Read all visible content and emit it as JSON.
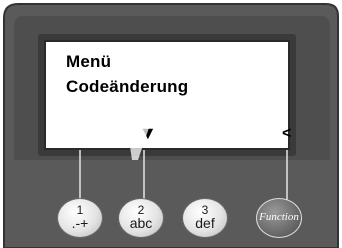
{
  "display": {
    "line1": "Menü",
    "line2": "Codeänderung",
    "selection_indicator": "▼",
    "back_indicator": "<"
  },
  "keys": [
    {
      "number": "1",
      "letters": ".-+"
    },
    {
      "number": "2",
      "letters": "abc"
    },
    {
      "number": "3",
      "letters": "def"
    },
    {
      "label": "Function"
    }
  ],
  "colors": {
    "panel": "#555555",
    "panel_edge": "#3a3a3a",
    "display_bg": "#ffffff",
    "display_text": "#000000",
    "key_light": "#e4e4e4",
    "key_dark": "#6e6e6e"
  }
}
